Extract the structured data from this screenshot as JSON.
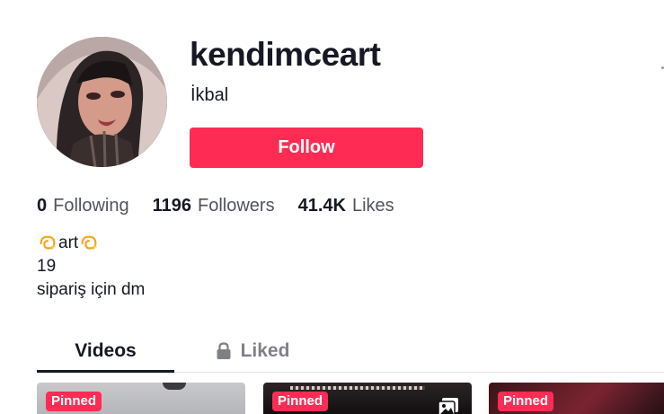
{
  "profile": {
    "username": "kendimceart",
    "nickname": "İkbal",
    "follow_label": "Follow"
  },
  "stats": [
    {
      "value": "0",
      "label": "Following"
    },
    {
      "value": "1196",
      "label": "Followers"
    },
    {
      "value": "41.4K",
      "label": "Likes"
    }
  ],
  "bio": {
    "line1_text": "art",
    "line2": "19",
    "line3": "sipariş için dm"
  },
  "tabs": {
    "videos": "Videos",
    "liked": "Liked"
  },
  "videos": [
    {
      "badge": "Pinned"
    },
    {
      "badge": "Pinned"
    },
    {
      "badge": "Pinned"
    }
  ],
  "colors": {
    "accent": "#fe2c55",
    "text": "#161823"
  },
  "icons": [
    "dizzy-sparkle-icon",
    "lock-icon",
    "photo-icon",
    "more-icon"
  ]
}
